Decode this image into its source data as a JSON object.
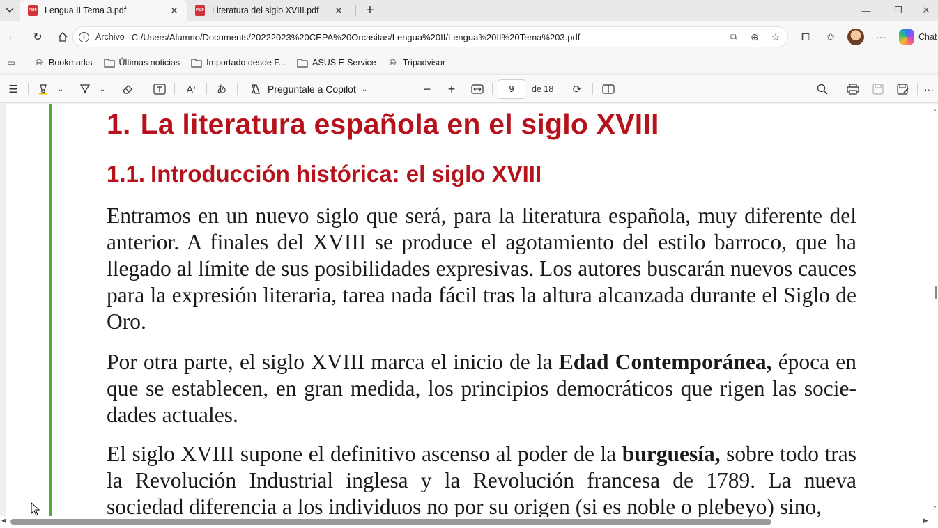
{
  "tabs": [
    {
      "title": "Lengua II Tema 3.pdf",
      "active": true,
      "icon": "pdf-icon"
    },
    {
      "title": "Literatura del siglo XVIII.pdf",
      "active": false,
      "icon": "pdf-icon"
    }
  ],
  "address_bar": {
    "origin_label": "Archivo",
    "url": "C:/Users/Alumno/Documents/20222023%20CEPA%20Orcasitas/Lengua%20II/Lengua%20II%20Tema%203.pdf"
  },
  "copilot": {
    "label": "Chat"
  },
  "bookmarks": [
    {
      "label": "Bookmarks",
      "icon": "globe-icon"
    },
    {
      "label": "Últimas noticias",
      "icon": "folder-icon"
    },
    {
      "label": "Importado desde F...",
      "icon": "folder-icon"
    },
    {
      "label": "ASUS E-Service",
      "icon": "folder-icon"
    },
    {
      "label": "Tripadvisor",
      "icon": "globe-icon"
    }
  ],
  "pdf_toolbar": {
    "ask_copilot_label": "Pregúntale a Copilot",
    "page_number": "9",
    "page_total": "de 18"
  },
  "document": {
    "h1_number": "1.",
    "h1_text": "La literatura española en el siglo XVIII",
    "h2_number": "1.1.",
    "h2_text": "Introducción histórica: el siglo XVIII",
    "p1": "Entramos en un nuevo siglo que será, para la literatura española, muy diferente del anterior. A finales del XVIII se produce el agotamiento del estilo barroco, que ha llegado al límite de sus posibilidades expresivas. Los autores buscarán nuevos cauces para la expresión literaria, tarea nada fácil tras la altura alcanzada durante el Siglo de Oro.",
    "p2_before": "Por otra parte, el siglo XVIII marca el inicio de la ",
    "p2_bold": "Edad Contemporánea,",
    "p2_after": " época en que se establecen, en gran medida, los principios democráticos que rigen las socie­dades actuales.",
    "p3_before": "El siglo XVIII supone el definitivo ascenso al poder de la ",
    "p3_bold": "burguesía,",
    "p3_after": " sobre todo tras la Revolución Industrial inglesa y la Revolución francesa de 1789. La nueva sociedad diferencia a los individuos no por su origen (si es noble o plebeyo) sino,"
  },
  "colors": {
    "heading_red": "#b5121b",
    "margin_rule_green": "#4caf35"
  }
}
